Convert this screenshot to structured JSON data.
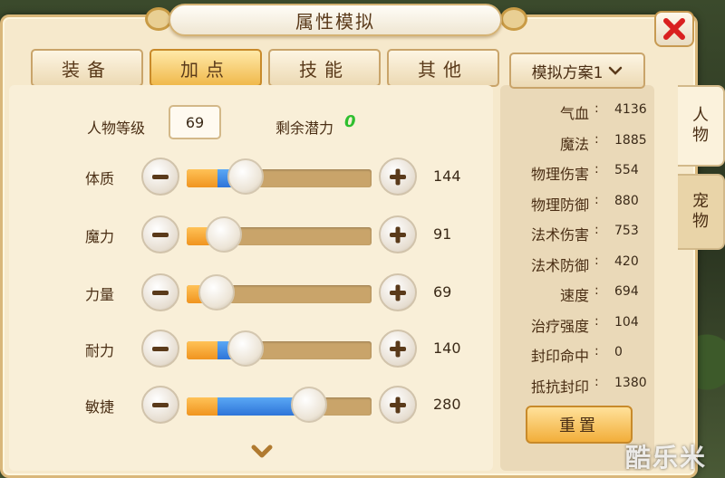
{
  "window": {
    "title": "属性模拟"
  },
  "tabs": [
    {
      "label": "装备",
      "active": false
    },
    {
      "label": "加点",
      "active": true
    },
    {
      "label": "技能",
      "active": false
    },
    {
      "label": "其他",
      "active": false
    }
  ],
  "level": {
    "label": "人物等级",
    "value": "69"
  },
  "potential": {
    "label": "剩余潜力",
    "value": "0"
  },
  "attributes": [
    {
      "name": "体质",
      "value": "144",
      "base_fraction": 0.165,
      "added_fraction": 0.09,
      "level_fraction": 0.32
    },
    {
      "name": "魔力",
      "value": "91",
      "base_fraction": 0.165,
      "added_fraction": 0.0,
      "level_fraction": 0.2
    },
    {
      "name": "力量",
      "value": "69",
      "base_fraction": 0.165,
      "added_fraction": 0.0,
      "level_fraction": 0.16
    },
    {
      "name": "耐力",
      "value": "140",
      "base_fraction": 0.165,
      "added_fraction": 0.08,
      "level_fraction": 0.32
    },
    {
      "name": "敏捷",
      "value": "280",
      "base_fraction": 0.165,
      "added_fraction": 0.47,
      "level_fraction": 0.66
    }
  ],
  "scheme": {
    "label": "模拟方案1"
  },
  "stats": [
    {
      "label": "气血",
      "value": "4136"
    },
    {
      "label": "魔法",
      "value": "1885"
    },
    {
      "label": "物理伤害",
      "value": "554"
    },
    {
      "label": "物理防御",
      "value": "880"
    },
    {
      "label": "法术伤害",
      "value": "753"
    },
    {
      "label": "法术防御",
      "value": "420"
    },
    {
      "label": "速度",
      "value": "694"
    },
    {
      "label": "治疗强度",
      "value": "104"
    },
    {
      "label": "封印命中",
      "value": "0"
    },
    {
      "label": "抵抗封印",
      "value": "1380"
    }
  ],
  "stat_separator": ":",
  "reset_label": "重置",
  "side_tabs": [
    {
      "label": "人物",
      "active": true
    },
    {
      "label": "宠物",
      "active": false
    }
  ],
  "watermark": "酷乐米",
  "colors": {
    "base_fill": "#f0941f",
    "added_fill": "#2e74d8",
    "potential": "#2fbf2f",
    "close_icon": "#d92020"
  },
  "icons": {
    "minus": "minus-icon",
    "plus": "plus-icon",
    "close": "close-icon",
    "dropdown": "chevron-down-icon",
    "scroll": "chevron-down-icon"
  }
}
